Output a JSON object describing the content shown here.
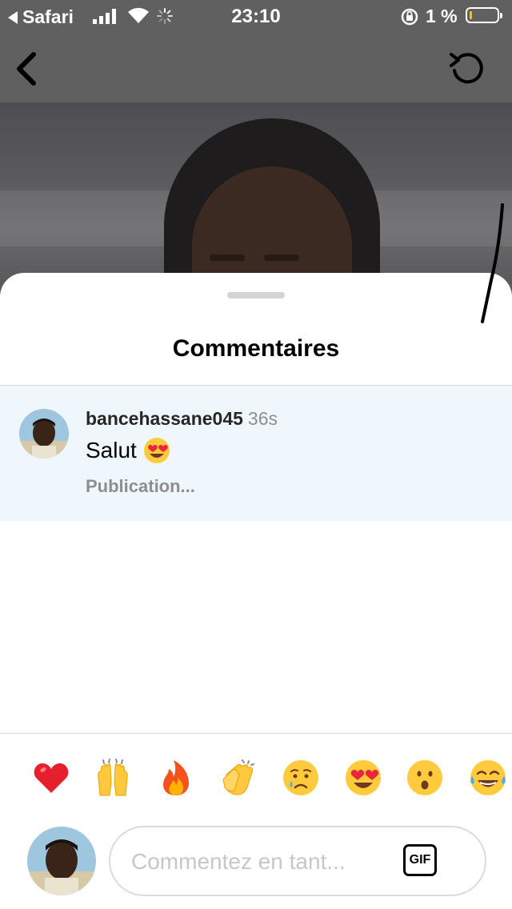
{
  "status_bar": {
    "back_app_label": "Safari",
    "time": "23:10",
    "battery_percent_label": "1 %",
    "battery_level": 0.01
  },
  "nav": {
    "back_icon": "chevron-left-icon",
    "refresh_icon": "refresh-icon"
  },
  "sheet": {
    "title": "Commentaires"
  },
  "comments": [
    {
      "username": "bancehassane045",
      "time": "36s",
      "text": "Salut",
      "emoji": "heart-eyes-emoji",
      "status": "Publication..."
    }
  ],
  "emoji_bar": [
    "heart",
    "raised-hands",
    "fire",
    "clapping-hands",
    "crying-face",
    "heart-eyes",
    "astonished-face",
    "tears-of-joy"
  ],
  "composer": {
    "placeholder": "Commentez en tant...",
    "gif_label": "GIF"
  },
  "colors": {
    "comment_highlight": "#eff7fc",
    "secondary_text": "#8e8e8e",
    "battery_fill": "#f5c400"
  }
}
